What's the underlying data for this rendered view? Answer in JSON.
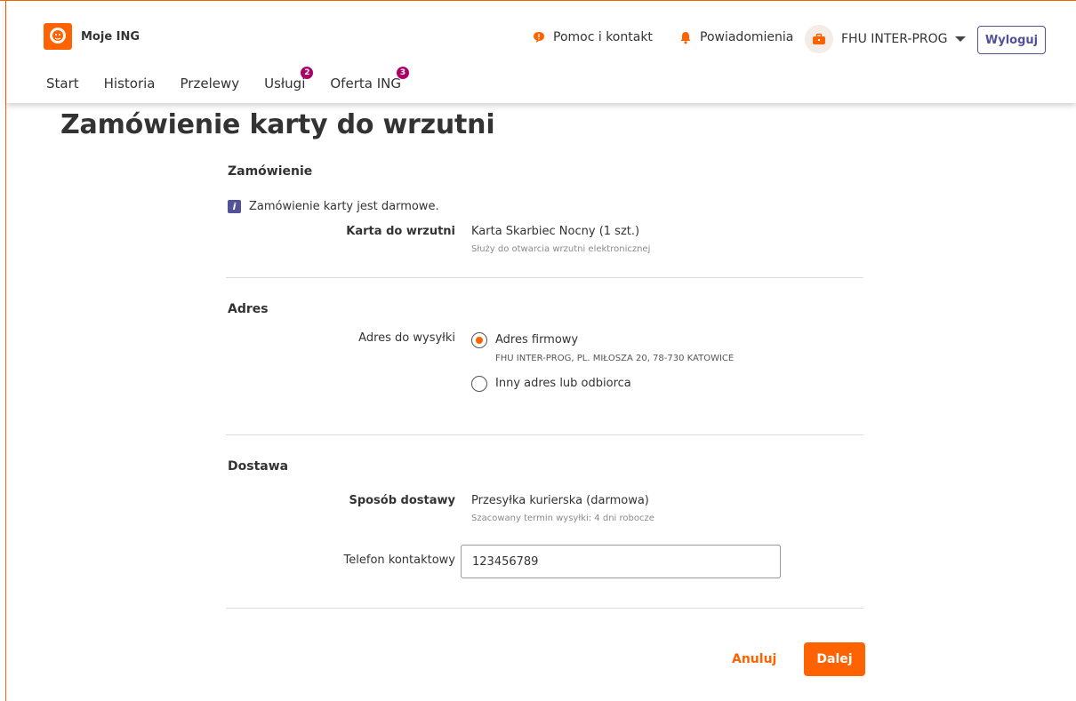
{
  "brand": {
    "name": "Moje ING",
    "logo_icon": "lion-icon",
    "accent": "#ff6200"
  },
  "header": {
    "help_label": "Pomoc i kontakt",
    "notifications_label": "Powiadomienia",
    "company_label": "FHU INTER-PROG",
    "logout_label": "Wyloguj"
  },
  "nav": {
    "items": [
      {
        "label": "Start"
      },
      {
        "label": "Historia"
      },
      {
        "label": "Przelewy"
      },
      {
        "label": "Usługi",
        "badge": "2"
      },
      {
        "label": "Oferta ING",
        "badge": "3"
      }
    ]
  },
  "page": {
    "title": "Zamówienie karty do wrzutni"
  },
  "order": {
    "heading": "Zamówienie",
    "info": "Zamówienie karty jest darmowe.",
    "card_label": "Karta do wrzutni",
    "card_value": "Karta Skarbiec Nocny (1 szt.)",
    "card_desc": "Służy do otwarcia wrzutni elektronicznej"
  },
  "address": {
    "heading": "Adres",
    "label": "Adres do wysyłki",
    "option1_label": "Adres firmowy",
    "option1_detail": "FHU INTER-PROG, PL. MIŁOSZA 20, 78-730 KATOWICE",
    "option2_label": "Inny adres lub odbiorca",
    "selected": "option1"
  },
  "delivery": {
    "heading": "Dostawa",
    "method_label": "Sposób dostawy",
    "method_value": "Przesyłka kurierska (darmowa)",
    "method_desc": "Szacowany termin wysyłki: 4 dni robocze",
    "phone_label": "Telefon kontaktowy",
    "phone_value": "123456789"
  },
  "actions": {
    "cancel_label": "Anuluj",
    "next_label": "Dalej"
  }
}
